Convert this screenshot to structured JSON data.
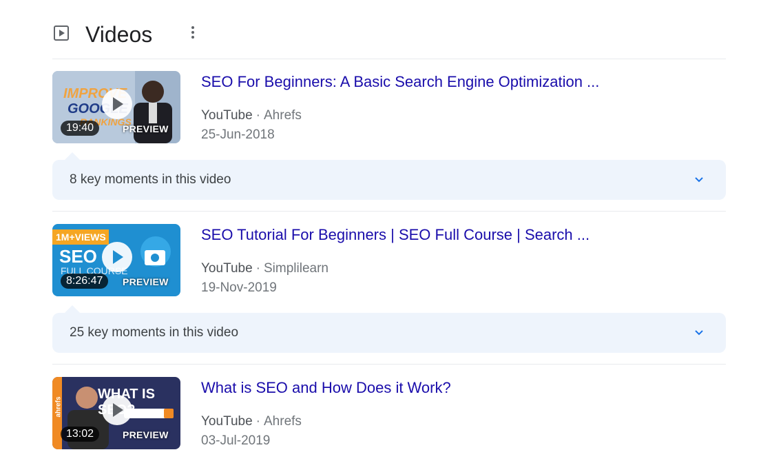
{
  "header": {
    "title": "Videos",
    "icon": "play-square-icon",
    "menu_icon": "more-vert-icon"
  },
  "videos": [
    {
      "title": "SEO For Beginners: A Basic Search Engine Optimization ...",
      "source": "YouTube",
      "separator": "·",
      "channel": "Ahrefs",
      "date": "25-Jun-2018",
      "duration": "19:40",
      "preview_label": "PREVIEW",
      "thumb_text": [
        "IMPROVE",
        "GOOGLE",
        "RANKINGS"
      ],
      "key_moments": "8 key moments in this video"
    },
    {
      "title": "SEO Tutorial For Beginners | SEO Full Course | Search ...",
      "source": "YouTube",
      "separator": "·",
      "channel": "Simplilearn",
      "date": "19-Nov-2019",
      "duration": "8:26:47",
      "preview_label": "PREVIEW",
      "thumb_text": [
        "1M+VIEWS",
        "SEO",
        "FULL COURSE"
      ],
      "key_moments": "25 key moments in this video"
    },
    {
      "title": "What is SEO and How Does it Work?",
      "source": "YouTube",
      "separator": "·",
      "channel": "Ahrefs",
      "date": "03-Jul-2019",
      "duration": "13:02",
      "preview_label": "PREVIEW",
      "thumb_text": [
        "WHAT IS SEO?",
        "ahrefs"
      ]
    }
  ],
  "colors": {
    "title_link": "#1a0dab",
    "moments_bg": "#eef4fc",
    "chevron": "#1a73e8"
  }
}
